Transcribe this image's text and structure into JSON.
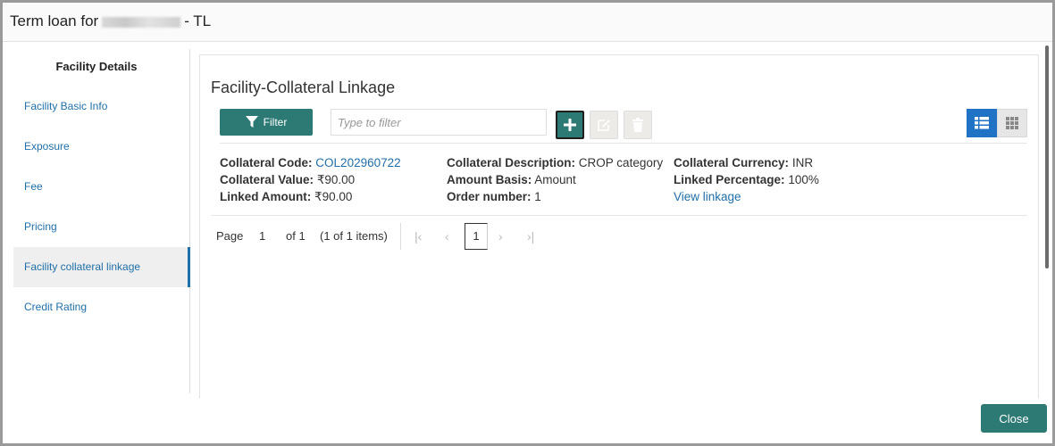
{
  "window": {
    "title_prefix": "Term loan for",
    "title_suffix": "- TL"
  },
  "sidebar": {
    "heading": "Facility Details",
    "items": [
      {
        "label": "Facility Basic Info"
      },
      {
        "label": "Exposure"
      },
      {
        "label": "Fee"
      },
      {
        "label": "Pricing"
      },
      {
        "label": "Facility collateral linkage"
      },
      {
        "label": "Credit Rating"
      }
    ],
    "active_index": 4
  },
  "main": {
    "title": "Facility-Collateral Linkage",
    "filter_label": "Filter",
    "filter_placeholder": "Type to filter"
  },
  "record": {
    "collateral_code_label": "Collateral Code:",
    "collateral_code_value": "COL202960722",
    "collateral_value_label": "Collateral Value:",
    "collateral_value_value": "₹90.00",
    "linked_amount_label": "Linked Amount:",
    "linked_amount_value": "₹90.00",
    "collateral_description_label": "Collateral Description:",
    "collateral_description_value": "CROP category",
    "amount_basis_label": "Amount Basis:",
    "amount_basis_value": "Amount",
    "order_number_label": "Order number:",
    "order_number_value": "1",
    "collateral_currency_label": "Collateral Currency:",
    "collateral_currency_value": "INR",
    "linked_percentage_label": "Linked Percentage:",
    "linked_percentage_value": "100%",
    "view_linkage_label": "View linkage"
  },
  "pager": {
    "page_label": "Page",
    "page_value": "1",
    "of_label": "of 1",
    "items_label": "(1 of 1 items)",
    "current_page": "1"
  },
  "footer": {
    "close_label": "Close"
  },
  "colors": {
    "accent": "#2d7a74",
    "link": "#1f6fa8",
    "view_active": "#1f72c4"
  }
}
